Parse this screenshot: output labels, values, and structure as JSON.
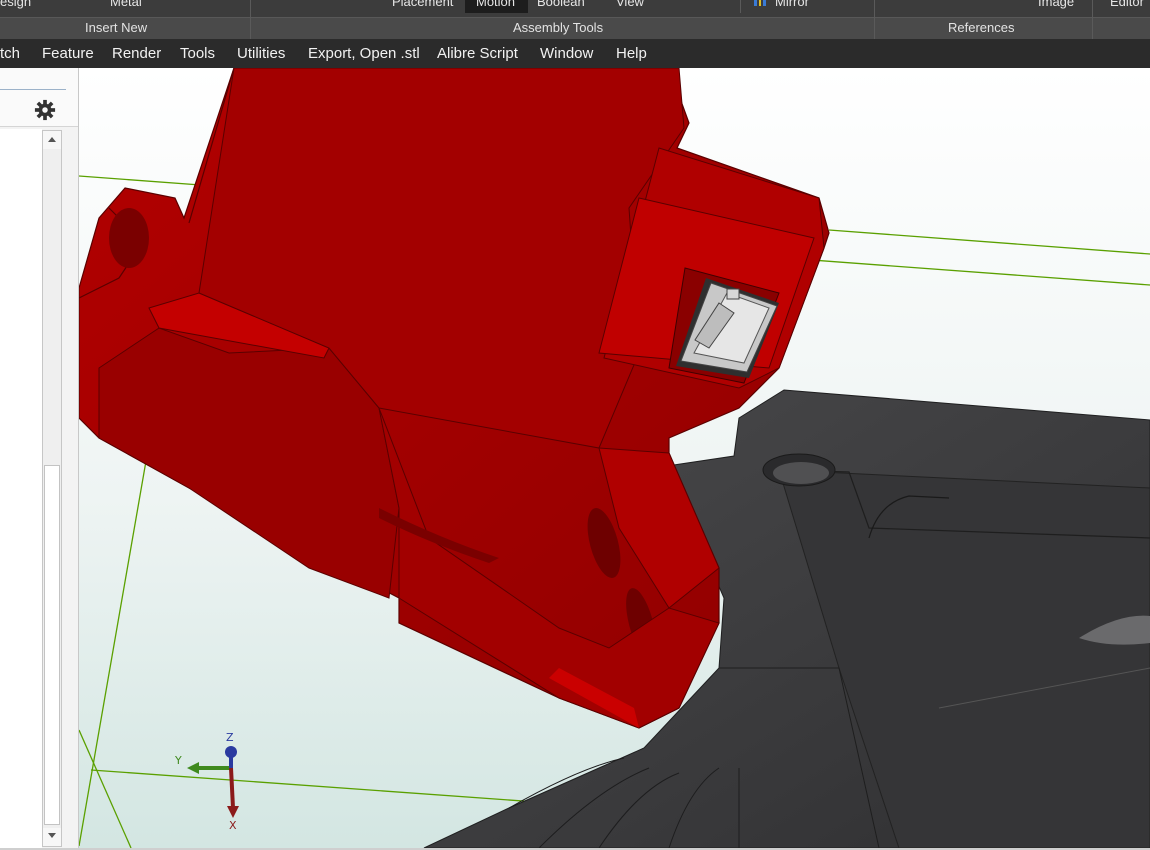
{
  "ribbon": {
    "top_labels": [
      "esign",
      "Metal",
      "Placement",
      "Motion",
      "Boolean",
      "View",
      "Mirror",
      "Image",
      "Editor"
    ],
    "groups": [
      "Insert New",
      "Assembly Tools",
      "References"
    ]
  },
  "menu": {
    "items": [
      "tch",
      "Feature",
      "Render",
      "Tools",
      "Utilities",
      "Export, Open .stl",
      "Alibre Script",
      "Window",
      "Help"
    ]
  },
  "triad": {
    "z_label": "Z",
    "y_label": "Y",
    "x_label": "X"
  },
  "colors": {
    "part_red": "#a80000",
    "part_dark": "#3f3f41",
    "sketch_green": "#5aa000",
    "background_top": "#ffffff",
    "background_bottom": "#dde9e6",
    "ribbon_bg": "#3c3c3c",
    "menubar_bg": "#2b2b2b"
  },
  "icons": [
    "gear-icon",
    "mirror-icon",
    "scroll-up-icon",
    "scroll-down-icon"
  ]
}
